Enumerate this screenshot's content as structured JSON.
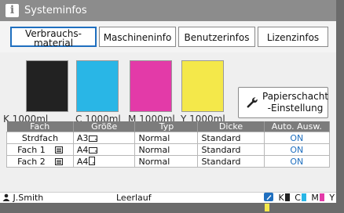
{
  "window": {
    "title": "Systeminfos",
    "title_icon": "info-icon"
  },
  "tabs": [
    {
      "label": "Verbrauchs-material",
      "active": true
    },
    {
      "label": "Maschineninfo",
      "active": false
    },
    {
      "label": "Benutzerinfos",
      "active": false
    },
    {
      "label": "Lizenzinfos",
      "active": false
    }
  ],
  "inks": [
    {
      "label": "K 1000ml",
      "color": "#222222"
    },
    {
      "label": "C 1000ml",
      "color": "#29b6e6"
    },
    {
      "label": "M 1000ml",
      "color": "#e33aa8"
    },
    {
      "label": "Y 1000ml",
      "color": "#f4e84a"
    }
  ],
  "paper_button": {
    "label": "Papierschacht -Einstellung",
    "icon": "wrench-icon"
  },
  "table": {
    "headers": [
      "Fach",
      "Größe",
      "Typ",
      "Dicke",
      "Auto. Ausw."
    ],
    "rows": [
      {
        "fach": "Strdfach",
        "groesse": "A3",
        "typ": "Normal",
        "dicke": "Standard",
        "auto": "ON",
        "list_icon": false,
        "orient": "landscape"
      },
      {
        "fach": "Fach 1",
        "groesse": "A4",
        "typ": "Normal",
        "dicke": "Standard",
        "auto": "ON",
        "list_icon": true,
        "orient": "landscape"
      },
      {
        "fach": "Fach 2",
        "groesse": "A4",
        "typ": "Normal",
        "dicke": "Standard",
        "auto": "ON",
        "list_icon": true,
        "orient": "portrait"
      }
    ]
  },
  "status": {
    "user": "J.Smith",
    "state": "Leerlauf",
    "ink_indicators": [
      "K",
      "C",
      "M",
      "Y"
    ]
  }
}
